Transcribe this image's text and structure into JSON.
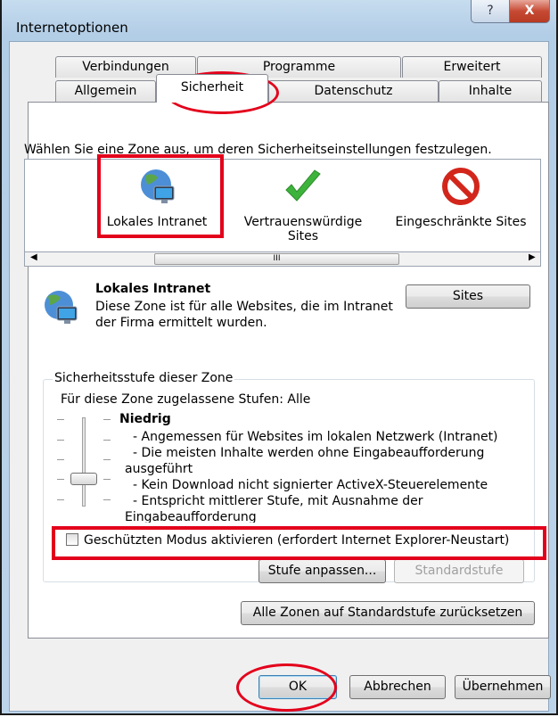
{
  "window": {
    "title": "Internetoptionen",
    "help_glyph": "?",
    "close_glyph": "X"
  },
  "tabs": {
    "row1": [
      "Verbindungen",
      "Programme",
      "Erweitert"
    ],
    "row2": [
      "Allgemein",
      "Sicherheit",
      "Datenschutz",
      "Inhalte"
    ],
    "selected": "Sicherheit"
  },
  "zones": {
    "instruction": "Wählen Sie eine Zone aus, um deren Sicherheitseinstellungen festzulegen.",
    "items": [
      {
        "label": "Lokales Intranet",
        "icon": "globe-network-icon"
      },
      {
        "label": "Vertrauenswürdige Sites",
        "line1": "Vertrauenswürdige",
        "line2": "Sites",
        "icon": "green-check-icon"
      },
      {
        "label": "Eingeschränkte Sites",
        "icon": "red-prohibited-icon"
      }
    ],
    "scroll_glyph": "III",
    "selected": "Lokales Intranet"
  },
  "zone_info": {
    "title": "Lokales Intranet",
    "desc_line1": "Diese Zone ist für alle Websites, die im Intranet",
    "desc_line2": "der Firma ermittelt wurden.",
    "sites_button": "Sites"
  },
  "security_level": {
    "group_label": "Sicherheitsstufe dieser Zone",
    "allowed_levels": "Für diese Zone zugelassene Stufen: Alle",
    "level_name": "Niedrig",
    "lines": [
      "- Angemessen für Websites im lokalen Netzwerk (Intranet)",
      "- Die meisten Inhalte werden ohne Eingabeaufforderung",
      "ausgeführt",
      "- Kein Download nicht signierter ActiveX-Steuerelemente",
      "- Entspricht mittlerer Stufe, mit Ausnahme der",
      "Eingabeaufforderung"
    ],
    "protected_mode_label": "Geschützten Modus aktivieren (erfordert Internet Explorer-Neustart)",
    "protected_mode_checked": false,
    "custom_button": "Stufe anpassen...",
    "default_button": "Standardstufe"
  },
  "reset_all_button": "Alle Zonen auf Standardstufe zurücksetzen",
  "footer": {
    "ok": "OK",
    "cancel": "Abbrechen",
    "apply": "Übernehmen"
  },
  "colors": {
    "highlight_red": "#e3001b",
    "titlebar": "#bcd4ea",
    "panel": "#ffffff"
  }
}
